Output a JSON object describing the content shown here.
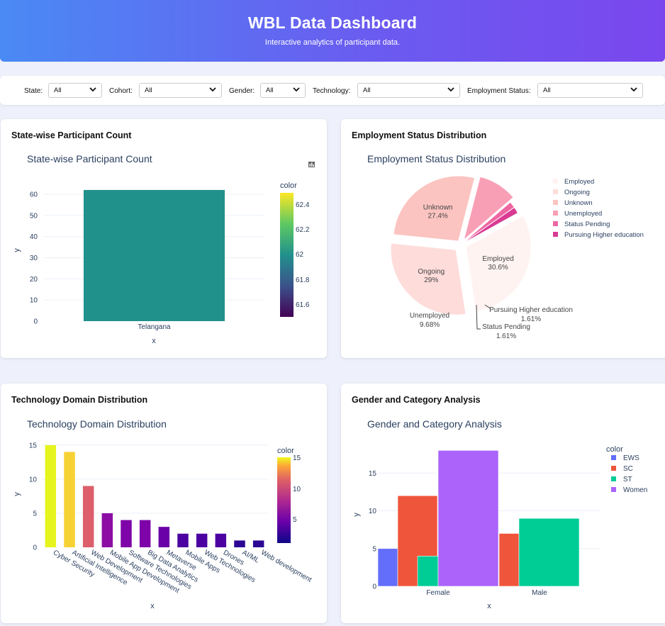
{
  "header": {
    "title": "WBL Data Dashboard",
    "subtitle": "Interactive analytics of participant data."
  },
  "filters": [
    {
      "label": "State:",
      "value": "All"
    },
    {
      "label": "Cohort:",
      "value": "All"
    },
    {
      "label": "Gender:",
      "value": "All"
    },
    {
      "label": "Technology:",
      "value": "All"
    },
    {
      "label": "Employment Status:",
      "value": "All"
    }
  ],
  "cards": {
    "state": {
      "heading": "State-wise Participant Count"
    },
    "employment": {
      "heading": "Employment Status Distribution"
    },
    "technology": {
      "heading": "Technology Domain Distribution"
    },
    "gender": {
      "heading": "Gender and Category Analysis"
    }
  },
  "chart_data": [
    {
      "type": "bar",
      "title": "State-wise Participant Count",
      "xlabel": "x",
      "ylabel": "y",
      "categories": [
        "Telangana"
      ],
      "values": [
        62
      ],
      "ylim": [
        0,
        65
      ],
      "yticks": [
        0,
        10,
        20,
        30,
        40,
        50,
        60
      ],
      "colorbar": {
        "title": "color",
        "ticks": [
          "62.4",
          "62.2",
          "62",
          "61.8",
          "61.6"
        ],
        "colorscale": "viridis"
      },
      "bar_color": "#21918c",
      "grid": true
    },
    {
      "type": "pie",
      "title": "Employment Status Distribution",
      "labels": [
        "Employed",
        "Ongoing",
        "Unknown",
        "Unemployed",
        "Status Pending",
        "Pursuing Higher education"
      ],
      "values": [
        30.6,
        29,
        27.4,
        9.68,
        1.61,
        1.61
      ],
      "value_labels": [
        "30.6%",
        "29%",
        "27.4%",
        "9.68%",
        "1.61%",
        "1.61%"
      ],
      "colors": [
        "#fff3f2",
        "#fddcda",
        "#fbc4c1",
        "#f89fb6",
        "#ee66a1",
        "#d93a94"
      ],
      "legend_placement": "right"
    },
    {
      "type": "bar",
      "title": "Technology Domain Distribution",
      "xlabel": "x",
      "ylabel": "y",
      "categories": [
        "Cyber Security",
        "Artificial Intelligence",
        "Web Development",
        "Mobile App Development",
        "Software Technologies",
        "Big Data Analytics",
        "Metaverse",
        "Mobile Apps",
        "Web Technologies",
        "Drones",
        "AI/ML",
        "Web development"
      ],
      "values": [
        15,
        14,
        9,
        5,
        4,
        4,
        3,
        2,
        2,
        2,
        1,
        1
      ],
      "bar_colors": [
        "#e6f41e",
        "#f6d234",
        "#dc5f6b",
        "#8c0da4",
        "#7e03a8",
        "#7e03a8",
        "#6a00a8",
        "#4c02a1",
        "#4c02a1",
        "#4c02a1",
        "#2c0594",
        "#2c0594"
      ],
      "ylim": [
        0,
        15.5
      ],
      "yticks": [
        0,
        5,
        10,
        15
      ],
      "colorbar": {
        "title": "color",
        "ticks": [
          "15",
          "10",
          "5"
        ],
        "colorscale": "plasma"
      },
      "grid": true
    },
    {
      "type": "bar",
      "title": "Gender and Category Analysis",
      "xlabel": "x",
      "ylabel": "y",
      "categories": [
        "Female",
        "Male"
      ],
      "series": [
        {
          "name": "EWS",
          "values": [
            5,
            0
          ],
          "color": "#636efa"
        },
        {
          "name": "SC",
          "values": [
            12,
            7
          ],
          "color": "#ef553b"
        },
        {
          "name": "ST",
          "values": [
            4,
            9
          ],
          "color": "#00cc96"
        },
        {
          "name": "Women",
          "values": [
            18,
            0
          ],
          "color": "#ab63fa"
        }
      ],
      "legend_title": "color",
      "ylim": [
        0,
        18.5
      ],
      "yticks": [
        0,
        5,
        10,
        15
      ],
      "legend_placement": "top-right",
      "grid": true
    }
  ]
}
